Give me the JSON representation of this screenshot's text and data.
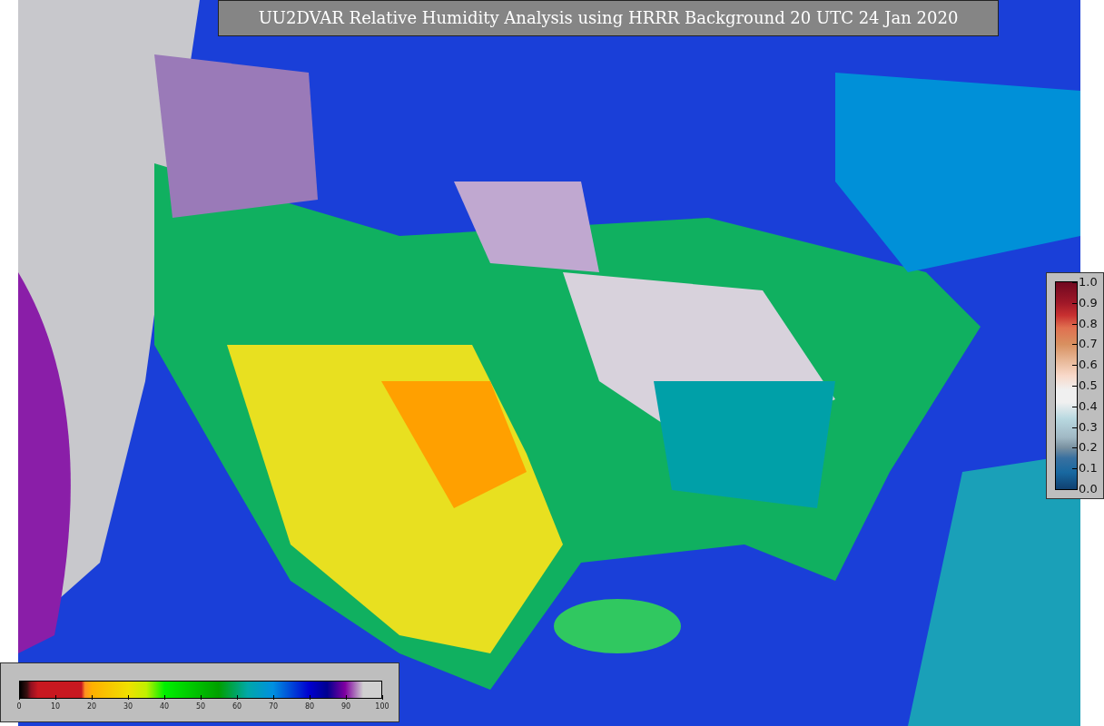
{
  "title": "UU2DVAR Relative Humidity Analysis using HRRR Background 20 UTC 24 Jan 2020",
  "humidity_colorbar": {
    "ticks": [
      "0",
      "10",
      "20",
      "30",
      "40",
      "50",
      "60",
      "70",
      "80",
      "90",
      "100"
    ]
  },
  "ratio_colorbar": {
    "ticks": [
      "1.0",
      "0.9",
      "0.8",
      "0.7",
      "0.6",
      "0.5",
      "0.4",
      "0.3",
      "0.2",
      "0.1",
      "0.0"
    ]
  }
}
